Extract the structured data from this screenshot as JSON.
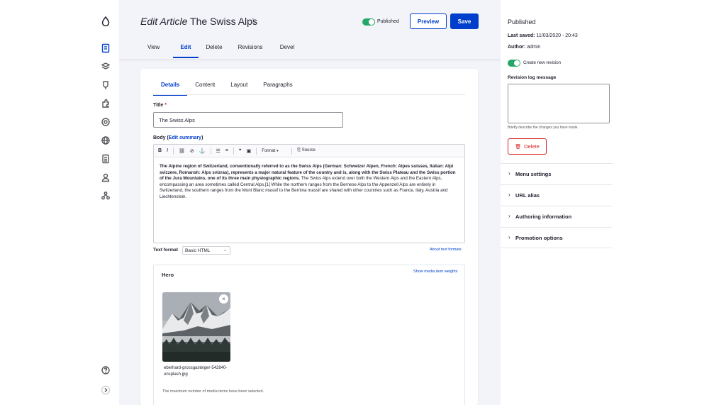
{
  "toolbar": {
    "logo_icon": "drop-icon",
    "items": [
      "content-icon",
      "structure-icon",
      "appearance-icon",
      "extend-icon",
      "config-icon",
      "globe-icon",
      "reports-icon",
      "people-icon",
      "devel-icon"
    ],
    "help_icon": "help-icon",
    "collapse_icon": "chevron-right-icon"
  },
  "header": {
    "title_prefix": "Edit Article",
    "title_name": "The Swiss Alps",
    "published_label": "Published",
    "preview_label": "Preview",
    "save_label": "Save",
    "tabs": [
      "View",
      "Edit",
      "Delete",
      "Revisions",
      "Devel"
    ],
    "active_tab": "Edit"
  },
  "form": {
    "tabs": [
      "Details",
      "Content",
      "Layout",
      "Paragraphs"
    ],
    "active_tab": "Details",
    "title_label": "Title",
    "title_required": "*",
    "title_value": "The Swiss Alps",
    "body_label": "Body",
    "body_edit_summary": "Edit summary",
    "editor_toolbar": {
      "bold": "B",
      "italic": "I",
      "format_label": "Format",
      "source_label": "Source"
    },
    "body_bold": "The Alpine region of Switzerland, conventionally referred to as the Swiss Alps (German: Schweizer Alpen, French: Alpes suisses, Italian: Alpi svizzere, Romansh: Alps svizras), represents a major natural feature of the country and is, along with the Swiss Plateau and the Swiss portion of the Jura Mountains, one of its three main physiographic regions.",
    "body_rest": "The Swiss Alps extend over both the Western Alps and the Eastern Alps, encompassing an area sometimes called Central Alps.[1] While the northern ranges from the Bernese Alps to the Appenzell Alps are entirely in Switzerland, the southern ranges from the Mont Blanc massif to the Bernina massif are shared with other countries such as France, Italy, Austria and Liechtenstein.",
    "text_format_label": "Text format",
    "text_format_value": "Basic HTML",
    "about_formats_link": "About text formats",
    "hero": {
      "title": "Hero",
      "weights_link": "Show media item weights",
      "close_glyph": "×",
      "filename": "eberhard-grossgasteiger-542840-unsplash.jpg",
      "max_note": "The maximum number of media items have been selected."
    }
  },
  "sidebar": {
    "status": "Published",
    "last_saved_label": "Last saved:",
    "last_saved_value": "11/03/2020 - 20:43",
    "author_label": "Author:",
    "author_value": "admin",
    "new_revision_label": "Create new revision",
    "revision_log_label": "Revision log message",
    "revision_help": "Briefly describe the changes you have made.",
    "delete_label": "Delete",
    "sections": [
      "Menu settings",
      "URL alias",
      "Authoring information",
      "Promotion options"
    ]
  },
  "colors": {
    "accent": "#003ecc",
    "success": "#26a769",
    "danger": "#d72222",
    "bg": "#f3f4f9"
  }
}
